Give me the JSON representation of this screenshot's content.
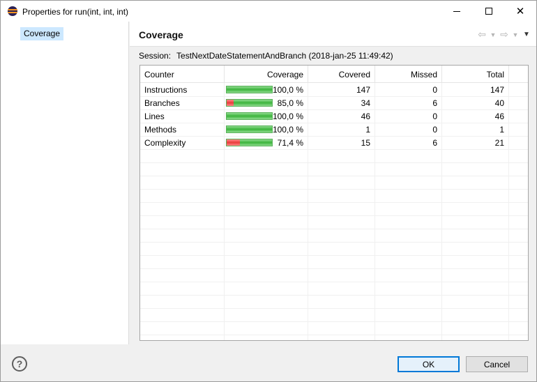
{
  "window": {
    "title": "Properties for run(int, int, int)",
    "close_glyph": "✕"
  },
  "leftnav": {
    "items": [
      {
        "label": "Coverage",
        "selected": true
      }
    ]
  },
  "pane": {
    "title": "Coverage",
    "session_label": "Session:",
    "session_value": "TestNextDateStatementAndBranch (2018-jan-25 11:49:42)",
    "nav_icons": [
      "back-arrow-icon",
      "dropdown-icon",
      "forward-arrow-icon",
      "dropdown-icon",
      "view-menu-icon"
    ]
  },
  "table": {
    "headers": [
      "Counter",
      "Coverage",
      "Covered",
      "Missed",
      "Total"
    ],
    "rows": [
      {
        "counter": "Instructions",
        "coverage": "100,0 %",
        "covered": "147",
        "missed": "0",
        "total": "147",
        "coverage_ratio": 1.0
      },
      {
        "counter": "Branches",
        "coverage": "85,0 %",
        "covered": "34",
        "missed": "6",
        "total": "40",
        "coverage_ratio": 0.85
      },
      {
        "counter": "Lines",
        "coverage": "100,0 %",
        "covered": "46",
        "missed": "0",
        "total": "46",
        "coverage_ratio": 1.0
      },
      {
        "counter": "Methods",
        "coverage": "100,0 %",
        "covered": "1",
        "missed": "0",
        "total": "1",
        "coverage_ratio": 1.0
      },
      {
        "counter": "Complexity",
        "coverage": "71,4 %",
        "covered": "15",
        "missed": "6",
        "total": "21",
        "coverage_ratio": 0.714
      }
    ]
  },
  "buttons": {
    "help": "?",
    "ok": "OK",
    "cancel": "Cancel"
  },
  "colors": {
    "covered": "#3cb43c",
    "missed": "#e93b3b",
    "selection": "#cce8ff",
    "default_button_border": "#0078d7"
  }
}
